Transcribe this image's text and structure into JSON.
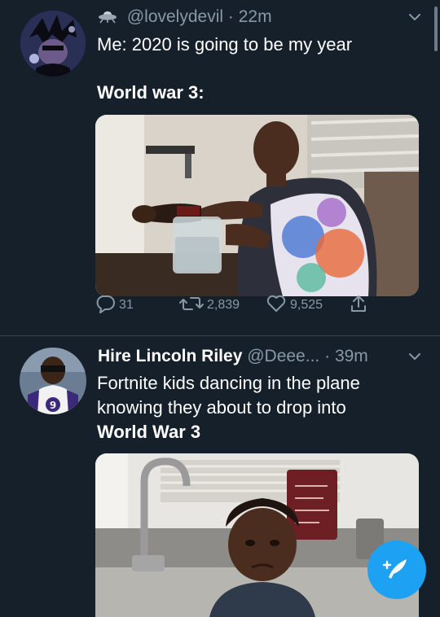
{
  "tweets": [
    {
      "display_name": "",
      "handle": "@lovelydevil",
      "sep": "·",
      "time": "22m",
      "lines": [
        "Me: 2020 is going to be my year",
        "World war 3:"
      ],
      "stats": {
        "replies": "31",
        "retweets": "2,839",
        "likes": "9,525"
      },
      "icons": {
        "badge": "ufo-icon",
        "reply": "reply-icon",
        "retweet": "retweet-icon",
        "like": "heart-icon",
        "share": "share-icon",
        "menu": "chevron-down-icon"
      }
    },
    {
      "display_name": "Hire Lincoln Riley",
      "handle": "@Deee...",
      "sep": "·",
      "time": "39m",
      "lines": [
        "Fortnite kids dancing in the plane",
        "knowing they about to drop into",
        "World War 3"
      ],
      "icons": {
        "menu": "chevron-down-icon"
      }
    }
  ],
  "compose": {
    "icon": "compose-tweet-icon"
  },
  "colors": {
    "background": "#15202b",
    "muted": "#8899a6",
    "accent": "#1da1f2",
    "divider": "#38444d"
  }
}
